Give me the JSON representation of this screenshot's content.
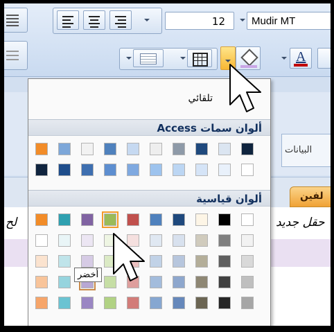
{
  "toolbar": {
    "font_size": "12",
    "font_name": "Mudir MT",
    "font_color_letter": "A"
  },
  "side": {
    "field_data_label": "البيانات",
    "tab_label": "لفين",
    "new_field_label": "حقل جديد",
    "left_label": "لح",
    "left_red": "ج"
  },
  "popup": {
    "automatic_label": "تلقائي",
    "access_theme_header": "ألوان سمات Access",
    "standard_header": "ألوان قياسية",
    "tooltip": "أخضر",
    "access_colors": [
      [
        "#f28c28",
        "#7da7d9",
        "#f2f2f2",
        "#4f81bd",
        "#c6d9f1",
        "#eeeeee",
        "#8e9aa8",
        "#1f497d",
        "#dbe5f1",
        "#0f243e"
      ],
      [
        "#10243e",
        "#1f4e8c",
        "#3e6fb0",
        "#5d8ed0",
        "#7fa9e0",
        "#9dc3ee",
        "#bcd6f3",
        "#d5e4f7",
        "#e9f1fb",
        "#ffffff"
      ]
    ],
    "standard_colors": [
      [
        "#f28c28",
        "#2fa0b0",
        "#8063a2",
        "#9bbb59",
        "#c0504d",
        "#4f81bd",
        "#1f497d",
        "#fdf5e6",
        "#000000",
        "#ffffff"
      ],
      [
        "#ffffff",
        "#e9f5f7",
        "#ece6f3",
        "#eef5e3",
        "#f5e0df",
        "#e0e8f2",
        "#d8e1ee",
        "#d0cbbd",
        "#7f7f7f",
        "#f2f2f2"
      ],
      [
        "#fbe3cf",
        "#bfe4ea",
        "#d6cbe5",
        "#dbeac5",
        "#ebc0bf",
        "#c1d2e7",
        "#b7c6dd",
        "#b4ae99",
        "#5f5f5f",
        "#d9d9d9"
      ],
      [
        "#f8c49a",
        "#96d4de",
        "#b8a8d4",
        "#c6dea5",
        "#de9e9c",
        "#a3bcdc",
        "#8ea7cd",
        "#8e8774",
        "#404040",
        "#bfbfbf"
      ],
      [
        "#f6a56a",
        "#6bc3d2",
        "#9a86c3",
        "#b1d284",
        "#d27c79",
        "#86a7d1",
        "#6688bb",
        "#6b6553",
        "#262626",
        "#a6a6a6"
      ]
    ]
  }
}
